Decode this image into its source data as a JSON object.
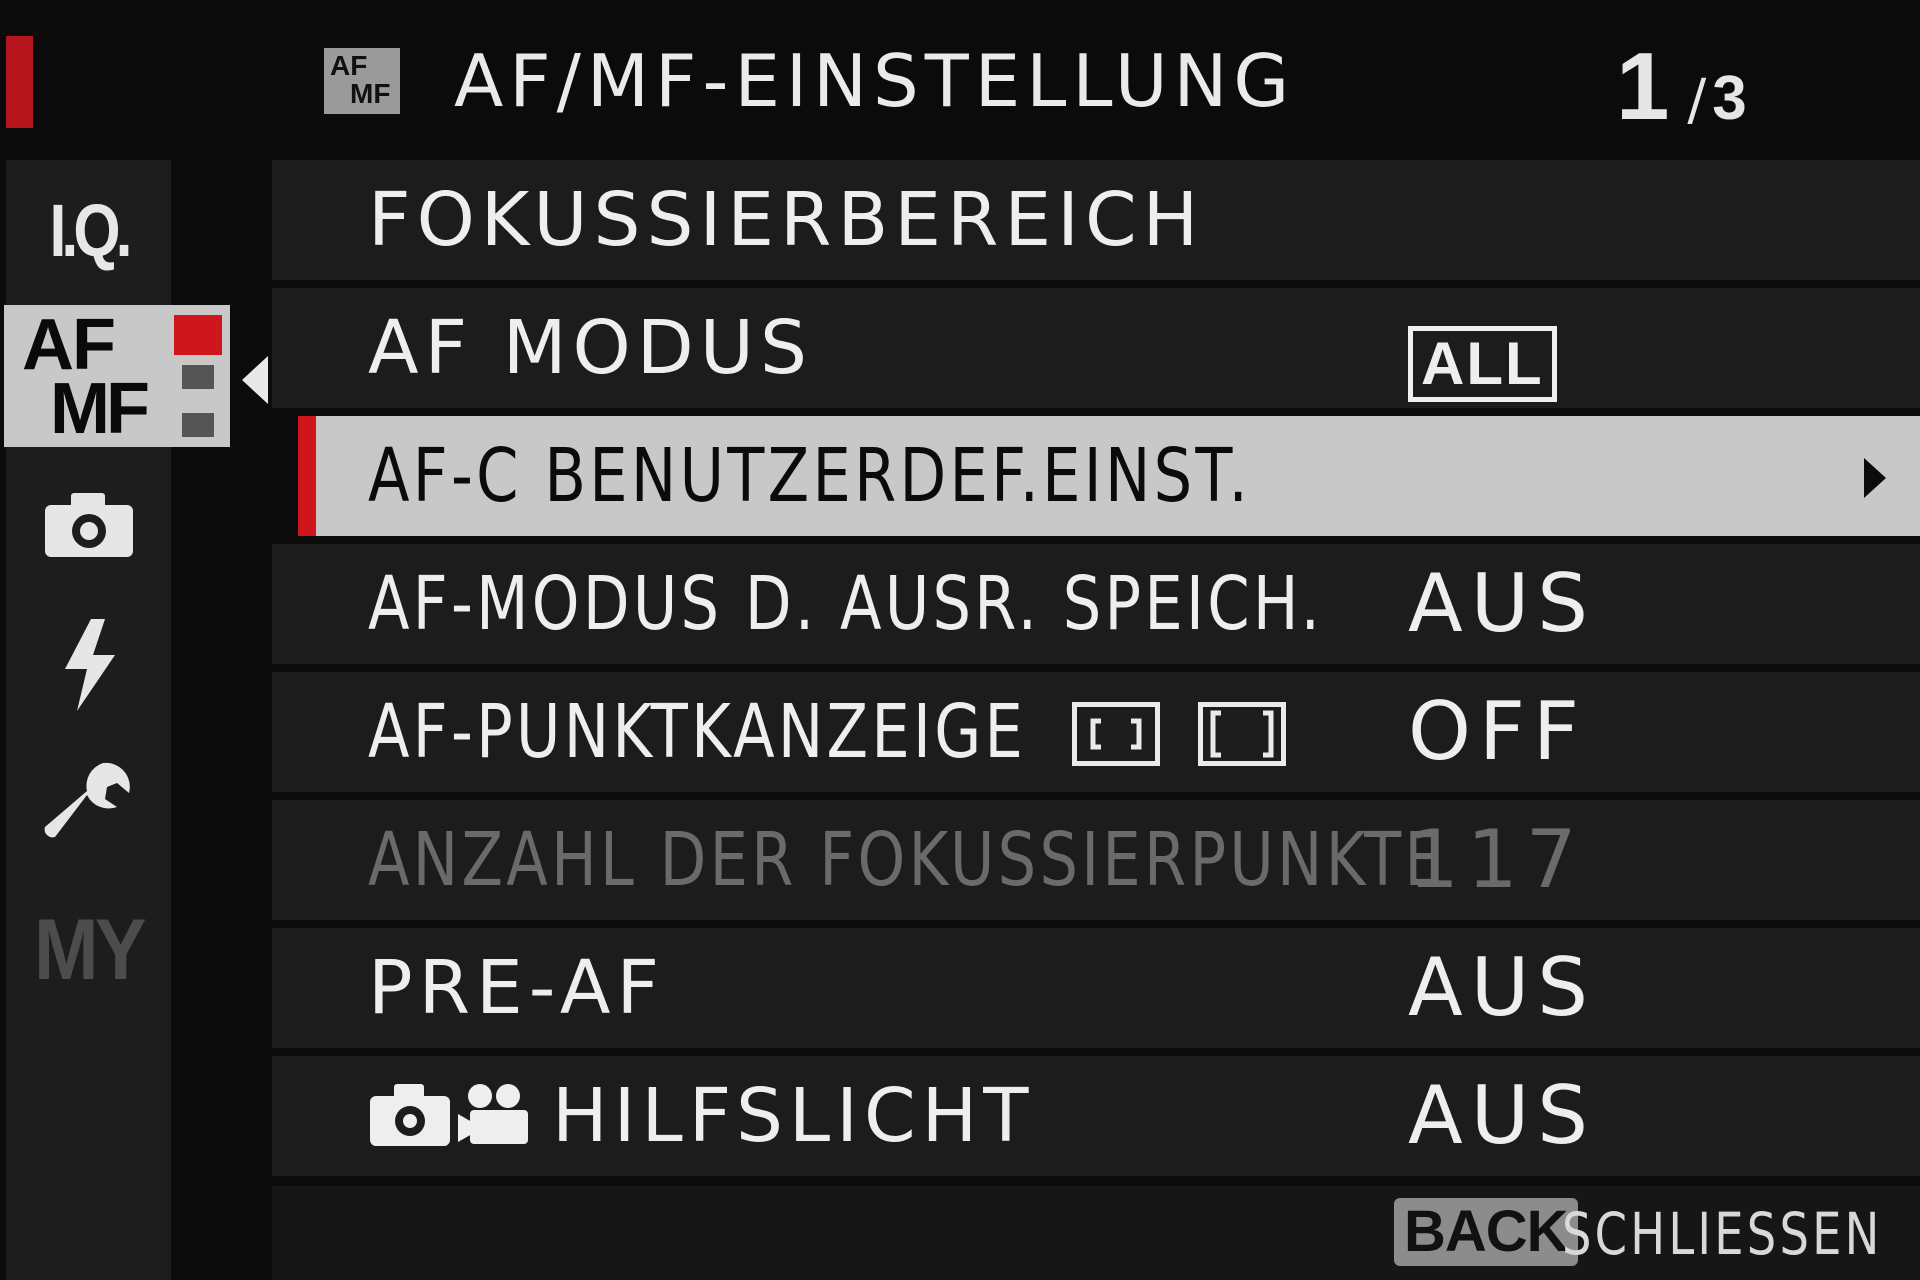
{
  "header": {
    "icon_top": "AF",
    "icon_bottom": "MF",
    "title": "AF/MF-EINSTELLUNG",
    "page_current": "1",
    "page_separator": "/",
    "page_total": "3"
  },
  "sidebar": {
    "tabs": [
      {
        "label": "I.Q."
      },
      {
        "label_top": "AF",
        "label_bottom": "MF",
        "selected": true
      },
      {
        "icon": "camera-icon"
      },
      {
        "icon": "flash-icon"
      },
      {
        "icon": "wrench-icon"
      },
      {
        "label": "MY"
      }
    ]
  },
  "menu": {
    "rows": [
      {
        "label": "FOKUSSIERBEREICH",
        "value": ""
      },
      {
        "label": "AF MODUS",
        "value": "ALL"
      },
      {
        "label": "AF-C BENUTZERDEF.EINST.",
        "value": "",
        "selected": true
      },
      {
        "label": "AF-MODUS D. AUSR. SPEICH.",
        "value": "AUS"
      },
      {
        "label": "AF-PUNKTKANZEIGE",
        "value": "OFF",
        "icons": [
          "small-frame-icon",
          "large-frame-icon"
        ]
      },
      {
        "label": "ANZAHL DER FOKUSSIERPUNKTE",
        "value": "117",
        "disabled": true
      },
      {
        "label": "PRE-AF",
        "value": "AUS"
      },
      {
        "label": "HILFSLICHT",
        "value": "AUS",
        "icons": [
          "camera-icon",
          "movie-icon"
        ]
      }
    ]
  },
  "footer": {
    "back_key": "BACK",
    "back_label": "SCHLIESSEN"
  },
  "colors": {
    "accent_red": "#d0161d",
    "selected_row": "#c8c8c8",
    "row_bg": "#1c1c1c",
    "disabled_text": "#6a6a6a"
  }
}
